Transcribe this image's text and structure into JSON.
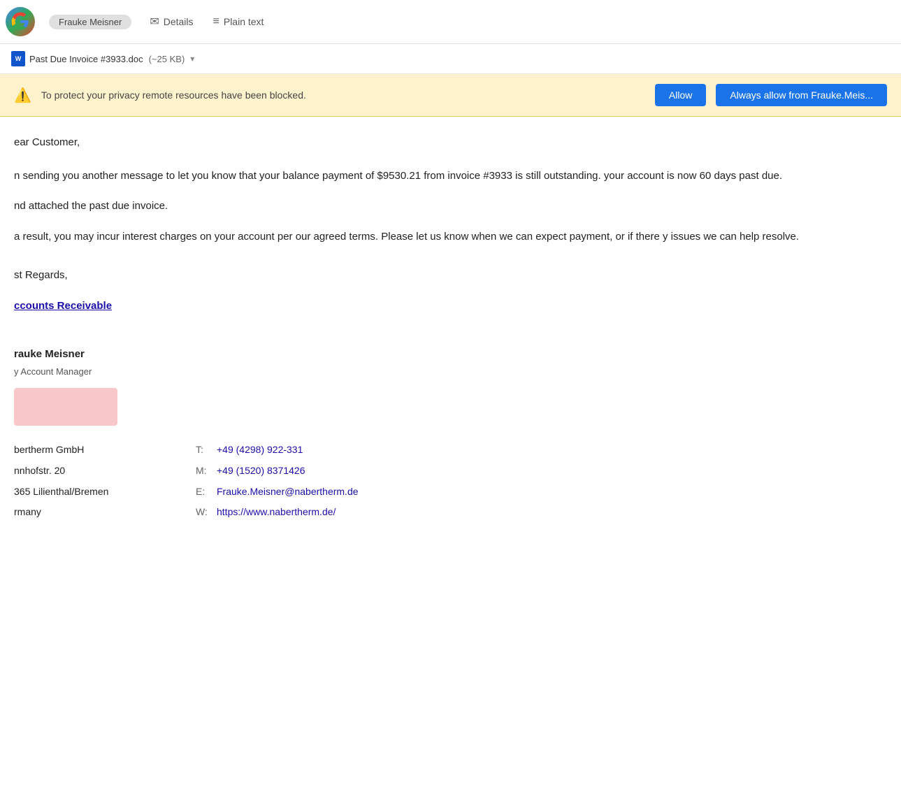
{
  "app": {
    "logo_letter": "G",
    "sender_name": "Frauke Meisner"
  },
  "tabs": [
    {
      "id": "details",
      "label": "Details",
      "icon": "✉"
    },
    {
      "id": "plain_text",
      "label": "Plain text",
      "icon": "≡"
    }
  ],
  "attachment": {
    "filename": "Past Due Invoice #3933.doc",
    "size": "(~25 KB)",
    "icon_text": "W"
  },
  "privacy_bar": {
    "warning_icon": "⚠",
    "message": "To protect your privacy remote resources have been blocked.",
    "allow_label": "Allow",
    "always_allow_label": "Always allow from Frauke.Meis..."
  },
  "email": {
    "greeting": "ear Customer,",
    "body_line1": "n sending you another message to let you know that your balance payment of $9530.21 from invoice #3933 is still outstanding. your account is now 60 days past due.",
    "body_line2": "nd attached the past due invoice.",
    "body_line3": "a result, you may incur interest charges on your account per our agreed terms. Please let us know when we can expect payment, or if there y issues we can help resolve.",
    "closing": "st Regards,",
    "accounts_link": "ccounts Receivable",
    "sender_name": "rauke Meisner",
    "sender_title": "y Account Manager"
  },
  "contact": {
    "company": "bertherm GmbH",
    "street": "nnhofstr. 20",
    "city": "365 Lilienthal/Bremen",
    "country": "rmany",
    "phone_label": "T:",
    "phone": "+49 (4298) 922-331",
    "mobile_label": "M:",
    "mobile": "+49 (1520) 8371426",
    "email_label": "E:",
    "email": "Frauke.Meisner@nabertherm.de",
    "web_label": "W:",
    "website": "https://www.nabertherm.de/"
  },
  "colors": {
    "privacy_bg": "#FFF3CD",
    "allow_btn": "#1a73e8",
    "link": "#1a0dab",
    "logo_placeholder_bg": "#f8c8c8"
  }
}
